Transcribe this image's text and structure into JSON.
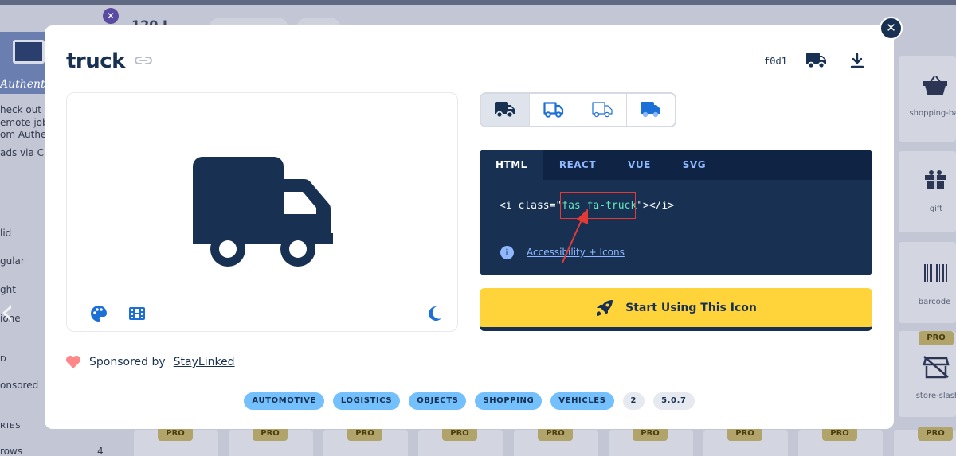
{
  "background": {
    "results_count": "120 I",
    "ad_brand": "Authenti",
    "ad_text_lines": [
      "heck out th",
      "emote job",
      "om Authen"
    ],
    "ad_via": "ads via C",
    "filters": [
      "lid",
      "gular",
      "ght",
      "ione"
    ],
    "section_d": "D",
    "sponsored": "onsored",
    "section_ries": "RIES",
    "rows_label": "rows",
    "rows_count": "4",
    "right_icons": [
      "shopping-bas",
      "gift",
      "barcode",
      "store-slash"
    ],
    "pro_label": "PRO"
  },
  "modal": {
    "icon_name": "truck",
    "unicode": "f0d1",
    "style_options": [
      "solid",
      "regular",
      "light",
      "duotone"
    ],
    "code_tabs": [
      "HTML",
      "REACT",
      "VUE",
      "SVG"
    ],
    "code": {
      "prefix": "<i class=\"",
      "class_value": "fas fa-truck",
      "suffix": "\"></i>"
    },
    "accessibility_link": "Accessibility + Icons",
    "start_button": "Start Using This Icon",
    "sponsor_prefix": "Sponsored by",
    "sponsor_name": "StayLinked",
    "tags": [
      "AUTOMOTIVE",
      "LOGISTICS",
      "OBJECTS",
      "SHOPPING",
      "VEHICLES"
    ],
    "meta_badges": [
      "2",
      "5.0.7"
    ]
  },
  "colors": {
    "navy": "#183153",
    "yellow": "#ffd43b",
    "tag_blue": "#74c0fc",
    "code_green": "#63e6be",
    "annotation_red": "#e53935"
  }
}
